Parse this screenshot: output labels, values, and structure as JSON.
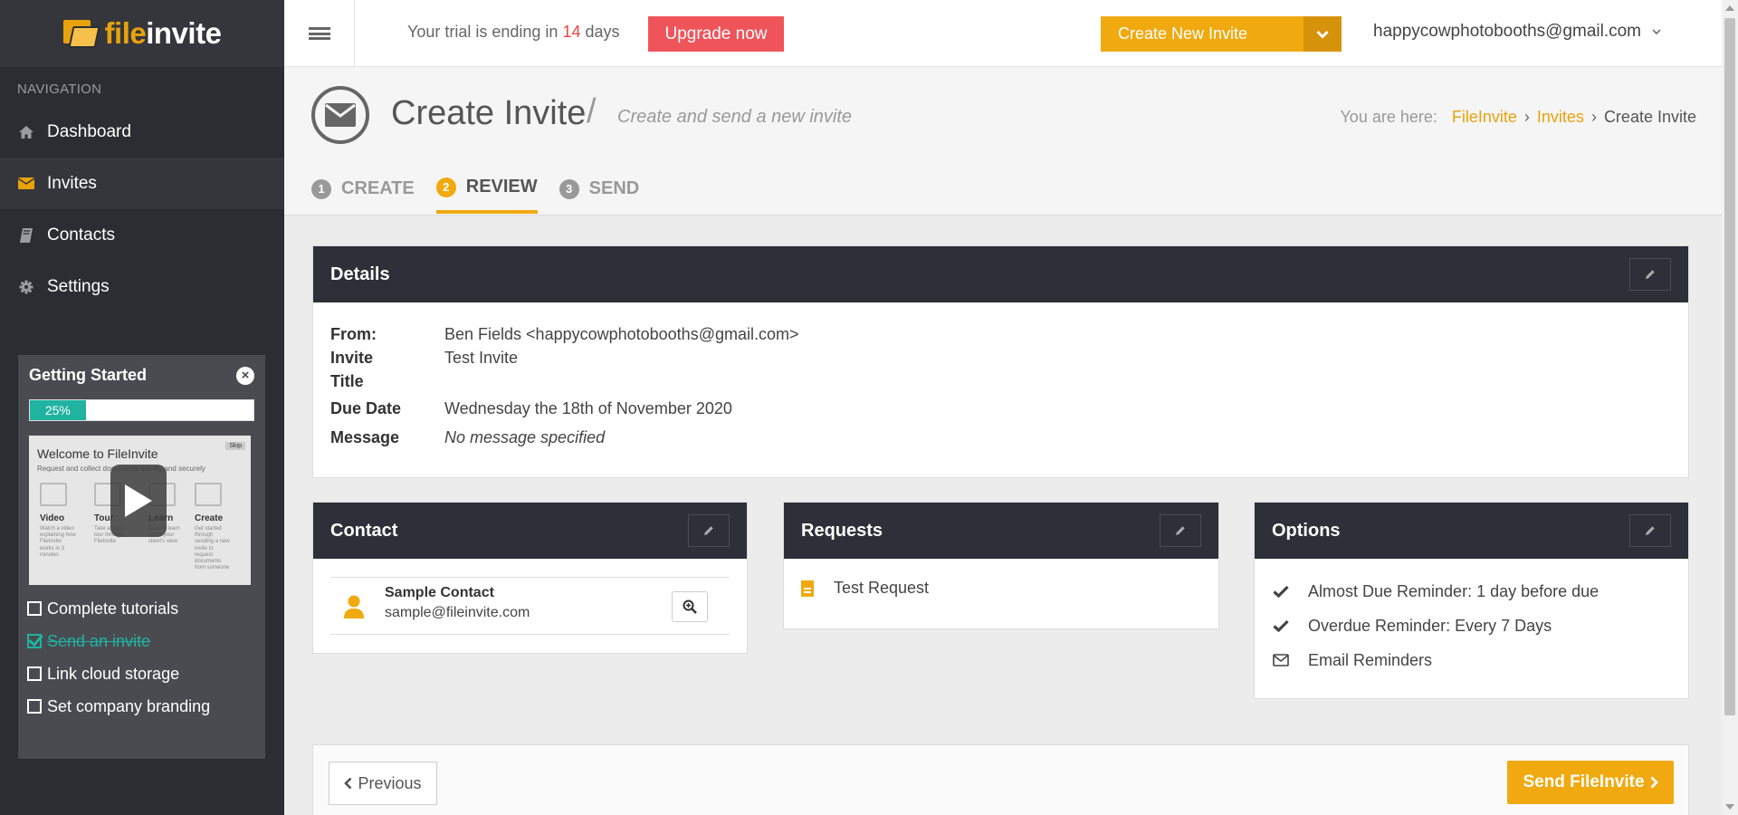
{
  "app": {
    "logo_file": "file",
    "logo_invite": "invite"
  },
  "sidebar": {
    "heading": "NAVIGATION",
    "items": [
      {
        "label": "Dashboard",
        "icon": "home-icon"
      },
      {
        "label": "Invites",
        "icon": "envelope-icon"
      },
      {
        "label": "Contacts",
        "icon": "book-icon"
      },
      {
        "label": "Settings",
        "icon": "gear-icon"
      }
    ],
    "getting_started": {
      "title": "Getting Started",
      "progress_label": "25%",
      "progress": 0.25,
      "video": {
        "title": "Welcome to FileInvite",
        "subtitle": "Request and collect documents quickly and securely",
        "skip": "Skip",
        "steps": [
          {
            "label": "Video",
            "text": "Watch a video explaining how FileInvite works in 3 minutes"
          },
          {
            "label": "Tour",
            "text": "Take a quick tour through FileInvite"
          },
          {
            "label": "Learn",
            "text": "Click to learn about your client's view"
          },
          {
            "label": "Create",
            "text": "Get started through sending a new invite to request documents from someone"
          }
        ]
      },
      "checklist": [
        {
          "label": "Complete tutorials",
          "done": false
        },
        {
          "label": "Send an invite",
          "done": true
        },
        {
          "label": "Link cloud storage",
          "done": false
        },
        {
          "label": "Set company branding",
          "done": false
        }
      ]
    }
  },
  "topbar": {
    "trial_prefix": "Your trial is ending in ",
    "trial_days": "14",
    "trial_suffix": " days",
    "upgrade_label": "Upgrade now",
    "create_label": "Create New Invite",
    "user_email": "happycowphotobooths@gmail.com"
  },
  "page": {
    "title": "Create Invite",
    "separator": "/",
    "subtitle": "Create and send a new invite",
    "breadcrumb": {
      "prefix": "You are here:",
      "items": [
        "FileInvite",
        "Invites",
        "Create Invite"
      ]
    },
    "steps": [
      {
        "num": "1",
        "label": "CREATE"
      },
      {
        "num": "2",
        "label": "REVIEW"
      },
      {
        "num": "3",
        "label": "SEND"
      }
    ]
  },
  "details": {
    "title": "Details",
    "rows": [
      {
        "key": "From:",
        "value": "Ben Fields <happycowphotobooths@gmail.com>"
      },
      {
        "key": "Invite Title",
        "value": "Test Invite"
      },
      {
        "key": "Due Date",
        "value": "Wednesday the 18th of November 2020"
      },
      {
        "key": "Message",
        "value": "No message specified"
      }
    ]
  },
  "contact": {
    "title": "Contact",
    "name": "Sample Contact",
    "email": "sample@fileinvite.com"
  },
  "requests": {
    "title": "Requests",
    "items": [
      "Test Request"
    ]
  },
  "options": {
    "title": "Options",
    "items": [
      {
        "label": "Almost Due Reminder: 1 day before due",
        "icon": "check-icon"
      },
      {
        "label": "Overdue Reminder: Every 7 Days",
        "icon": "check-icon"
      },
      {
        "label": "Email Reminders",
        "icon": "envelope-outline-icon"
      }
    ]
  },
  "actions": {
    "previous_label": "Previous",
    "send_label": "Send FileInvite"
  },
  "colors": {
    "accent": "#f0a90f",
    "danger": "#f0545b",
    "teal": "#1fb3a0",
    "sidebar": "#2c2d33",
    "card_header": "#2e2f38"
  }
}
